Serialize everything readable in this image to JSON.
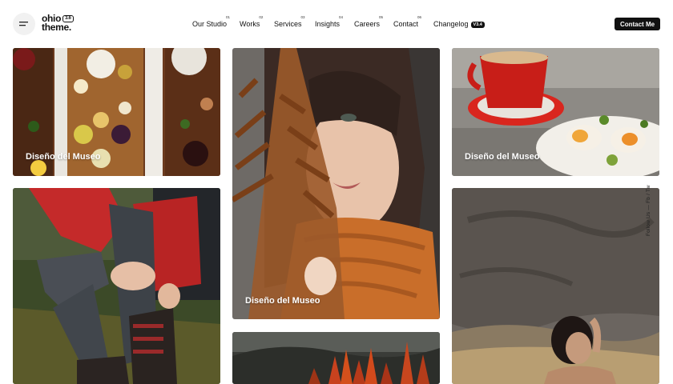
{
  "brand": {
    "name_line1": "ohio",
    "name_line2": "theme.",
    "version": "3.6"
  },
  "menu_icon": "hamburger-icon",
  "nav": [
    {
      "label": "Our Studio",
      "num": "01"
    },
    {
      "label": "Works",
      "num": "02"
    },
    {
      "label": "Services",
      "num": "03"
    },
    {
      "label": "Insights",
      "num": "04"
    },
    {
      "label": "Careers",
      "num": "05"
    },
    {
      "label": "Contact",
      "num": "06"
    },
    {
      "label": "Changelog",
      "badge": "V3.4"
    }
  ],
  "contact_button": "Contact Me",
  "tiles": [
    {
      "caption": "Diseño del Museo",
      "subject": "food-table-photo"
    },
    {
      "caption": "",
      "subject": "hiker-boots-photo"
    },
    {
      "caption": "Diseño del Museo",
      "subject": "woman-fern-photo"
    },
    {
      "caption": "",
      "subject": "autumn-trees-photo"
    },
    {
      "caption": "Diseño del Museo",
      "subject": "coffee-breakfast-photo"
    },
    {
      "caption": "",
      "subject": "woman-rock-photo"
    }
  ],
  "side_social": {
    "label": "Follow Us",
    "dash": "—",
    "links": [
      "Fb",
      "/",
      "Tw"
    ]
  },
  "colors": {
    "accent": "#111111",
    "background": "#ffffff",
    "caption": "#ffffff"
  }
}
